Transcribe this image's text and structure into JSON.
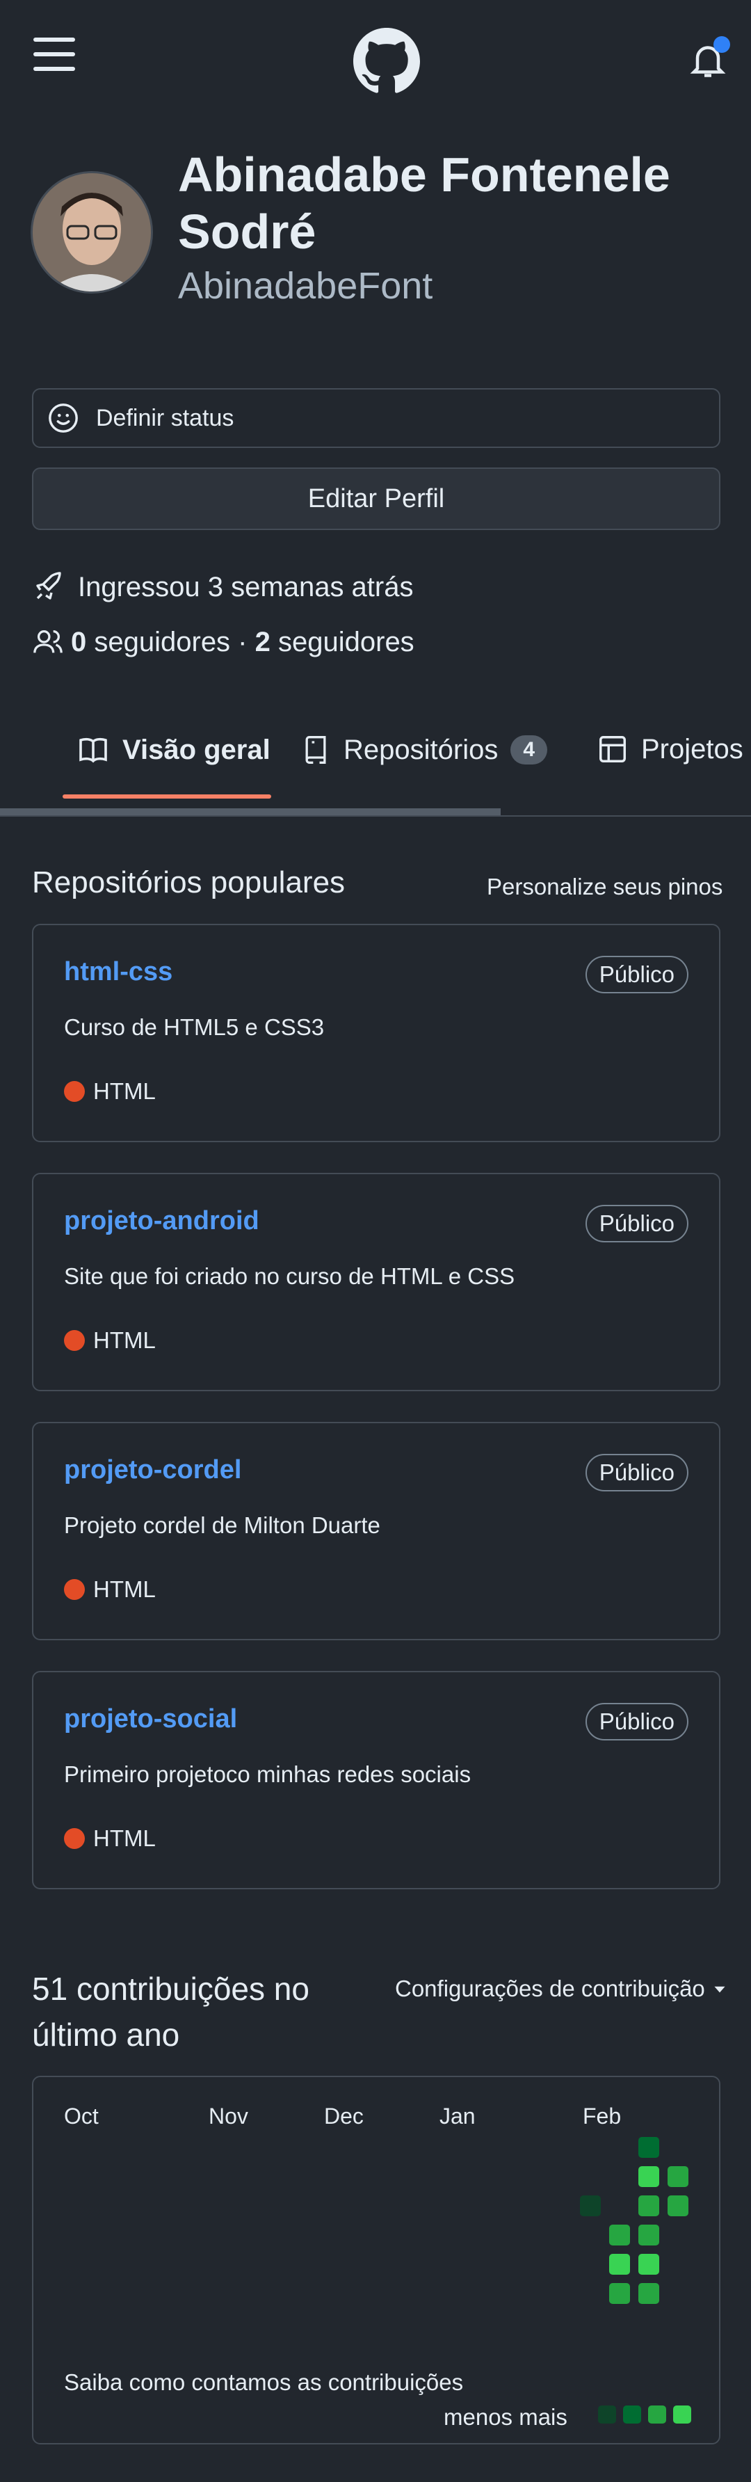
{
  "header": {
    "menu_icon": "hamburger-menu-icon",
    "logo_icon": "github-octocat-icon",
    "bell_icon": "bell-icon",
    "notification_color": "#2f81f7"
  },
  "profile": {
    "full_name": "Abinadabe Fontenele Sodré",
    "login": "AbinadabeFont",
    "status_label": "Definir status",
    "edit_label": "Editar Perfil",
    "joined": "Ingressou 3 semanas atrás",
    "followers_count": "0",
    "followers_label": "seguidores ·",
    "following_count": "2",
    "following_label": "seguidores"
  },
  "tabs": [
    {
      "label": "Visão geral",
      "icon": "book-icon",
      "active": true
    },
    {
      "label": "Repositórios",
      "icon": "repo-icon",
      "count": "4"
    },
    {
      "label": "Projetos",
      "icon": "table-icon"
    }
  ],
  "popular": {
    "title": "Repositórios populares",
    "customize": "Personalize seus pinos",
    "repos": [
      {
        "name": "html-css",
        "visibility": "Público",
        "description": "Curso de HTML5 e CSS3",
        "language": "HTML",
        "language_color": "#e34c26"
      },
      {
        "name": "projeto-android",
        "visibility": "Público",
        "description": "Site que foi criado no curso de HTML e CSS",
        "language": "HTML",
        "language_color": "#e34c26"
      },
      {
        "name": "projeto-cordel",
        "visibility": "Público",
        "description": "Projeto cordel de Milton Duarte",
        "language": "HTML",
        "language_color": "#e34c26"
      },
      {
        "name": "projeto-social",
        "visibility": "Público",
        "description": "Primeiro projetoco minhas redes sociais",
        "language": "HTML",
        "language_color": "#e34c26"
      }
    ]
  },
  "contributions": {
    "title": "51 contribuições no último ano",
    "settings": "Configurações de contribuição",
    "months": [
      "Oct",
      "Nov",
      "Dec",
      "Jan",
      "Feb"
    ],
    "learn": "Saiba como contamos as contribuições",
    "legend": "menos mais",
    "colors": {
      "l1": "#0e4429",
      "l2": "#006d32",
      "l3": "#26a641",
      "l4": "#39d353"
    }
  }
}
